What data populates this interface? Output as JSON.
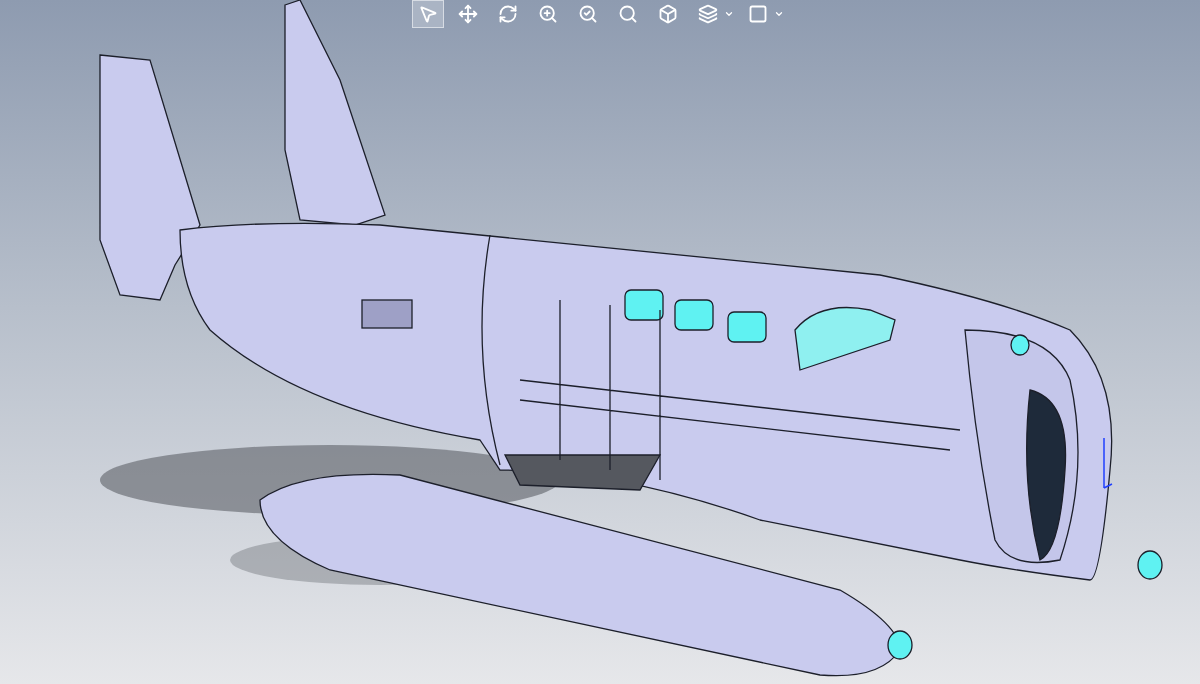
{
  "toolbar": {
    "tools": [
      {
        "kind": "select",
        "selected": true,
        "menu": false
      },
      {
        "kind": "pan",
        "selected": false,
        "menu": false
      },
      {
        "kind": "rotate",
        "selected": false,
        "menu": false
      },
      {
        "kind": "zoom-fit",
        "selected": false,
        "menu": false
      },
      {
        "kind": "zoom-area",
        "selected": false,
        "menu": false
      },
      {
        "kind": "zoom-previous",
        "selected": false,
        "menu": false
      },
      {
        "kind": "shaded",
        "selected": false,
        "menu": false
      },
      {
        "kind": "view-orientation",
        "selected": false,
        "menu": true
      },
      {
        "kind": "display-style",
        "selected": false,
        "menu": true
      }
    ]
  }
}
